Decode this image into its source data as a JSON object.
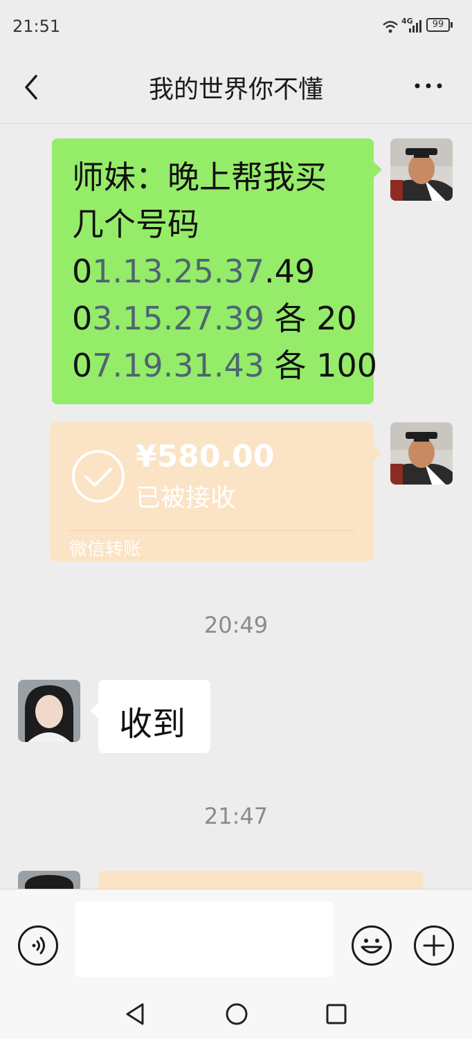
{
  "status_bar": {
    "time": "21:51",
    "network": "4G",
    "battery": "99"
  },
  "header": {
    "title": "我的世界你不懂"
  },
  "messages": {
    "m1": {
      "line1": "师妹：晚上帮我买",
      "line2": "几个号码",
      "line3_prefix": "0",
      "line3_dim": "1.13.25.37",
      "line3_suffix": ".49",
      "line4_prefix": "0",
      "line4_dim": "3.15.27.39",
      "line4_suffix": " 各 20",
      "line5_prefix": "0",
      "line5_dim": "7.19.31.43",
      "line5_suffix": " 各 100"
    },
    "transfer": {
      "amount": "¥580.00",
      "status": "已被接收",
      "label": "微信转账"
    },
    "time1": "20:49",
    "reply": "收到",
    "time2": "21:47"
  },
  "colors": {
    "sent_bubble": "#95ec69",
    "transfer_card": "#fbe3c5",
    "background": "#ededed"
  }
}
